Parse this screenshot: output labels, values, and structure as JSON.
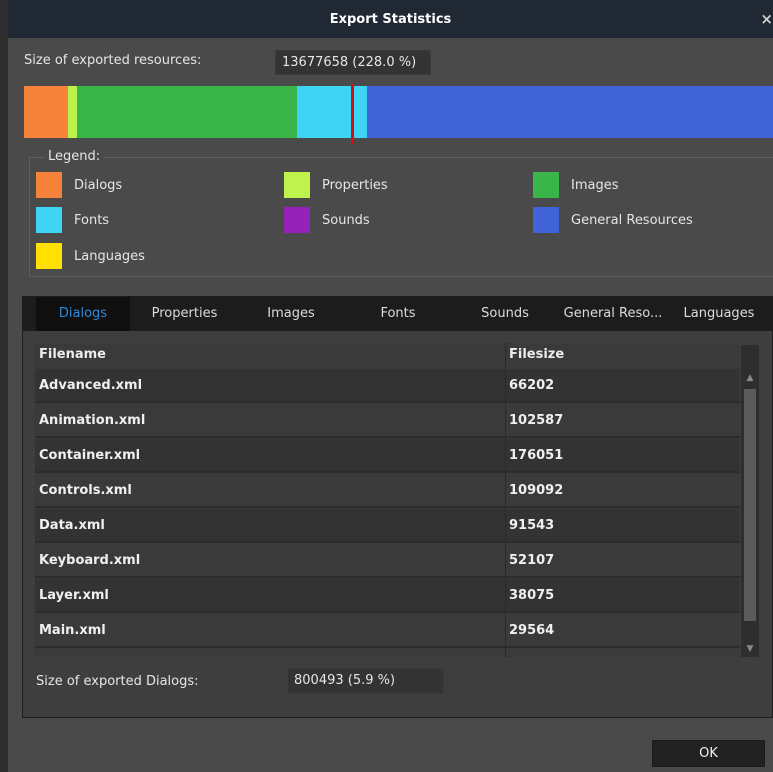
{
  "window": {
    "title": "Export Statistics",
    "close_glyph": "×"
  },
  "summary": {
    "label": "Size of exported resources:",
    "value": "13677658 (228.0 %)"
  },
  "usage_bar": {
    "segments": [
      {
        "name": "Dialogs",
        "color": "#f5833a",
        "share": 0.059
      },
      {
        "name": "Properties",
        "color": "#b8f24a",
        "share": 0.012
      },
      {
        "name": "Images",
        "color": "#39b54a",
        "share": 0.294
      },
      {
        "name": "Fonts",
        "color": "#3dd4f5",
        "share": 0.093
      },
      {
        "name": "General Resources",
        "color": "#4163d8",
        "share": 0.542
      }
    ],
    "marker_color": "#d40f0f"
  },
  "legend": {
    "title": "Legend:",
    "items": [
      {
        "label": "Dialogs",
        "color": "#f5833a"
      },
      {
        "label": "Properties",
        "color": "#c0f24d"
      },
      {
        "label": "Images",
        "color": "#39b54a"
      },
      {
        "label": "Fonts",
        "color": "#3dd4f5"
      },
      {
        "label": "Sounds",
        "color": "#9421b8"
      },
      {
        "label": "General Resources",
        "color": "#4163d8"
      },
      {
        "label": "Languages",
        "color": "#ffe000"
      }
    ]
  },
  "tabs": [
    {
      "label": "Dialogs",
      "active": true
    },
    {
      "label": "Properties"
    },
    {
      "label": "Images"
    },
    {
      "label": "Fonts"
    },
    {
      "label": "Sounds"
    },
    {
      "label": "General Reso..."
    },
    {
      "label": "Languages"
    }
  ],
  "table": {
    "columns": [
      "Filename",
      "Filesize"
    ],
    "rows": [
      [
        "Advanced.xml",
        "66202"
      ],
      [
        "Animation.xml",
        "102587"
      ],
      [
        "Container.xml",
        "176051"
      ],
      [
        "Controls.xml",
        "109092"
      ],
      [
        "Data.xml",
        "91543"
      ],
      [
        "Keyboard.xml",
        "52107"
      ],
      [
        "Layer.xml",
        "38075"
      ],
      [
        "Main.xml",
        "29564"
      ]
    ]
  },
  "scrollbar": {
    "up_glyph": "▲",
    "down_glyph": "▼"
  },
  "footer": {
    "label": "Size of exported Dialogs:",
    "value": "800493 (5.9 %)"
  },
  "ok_label": "OK"
}
